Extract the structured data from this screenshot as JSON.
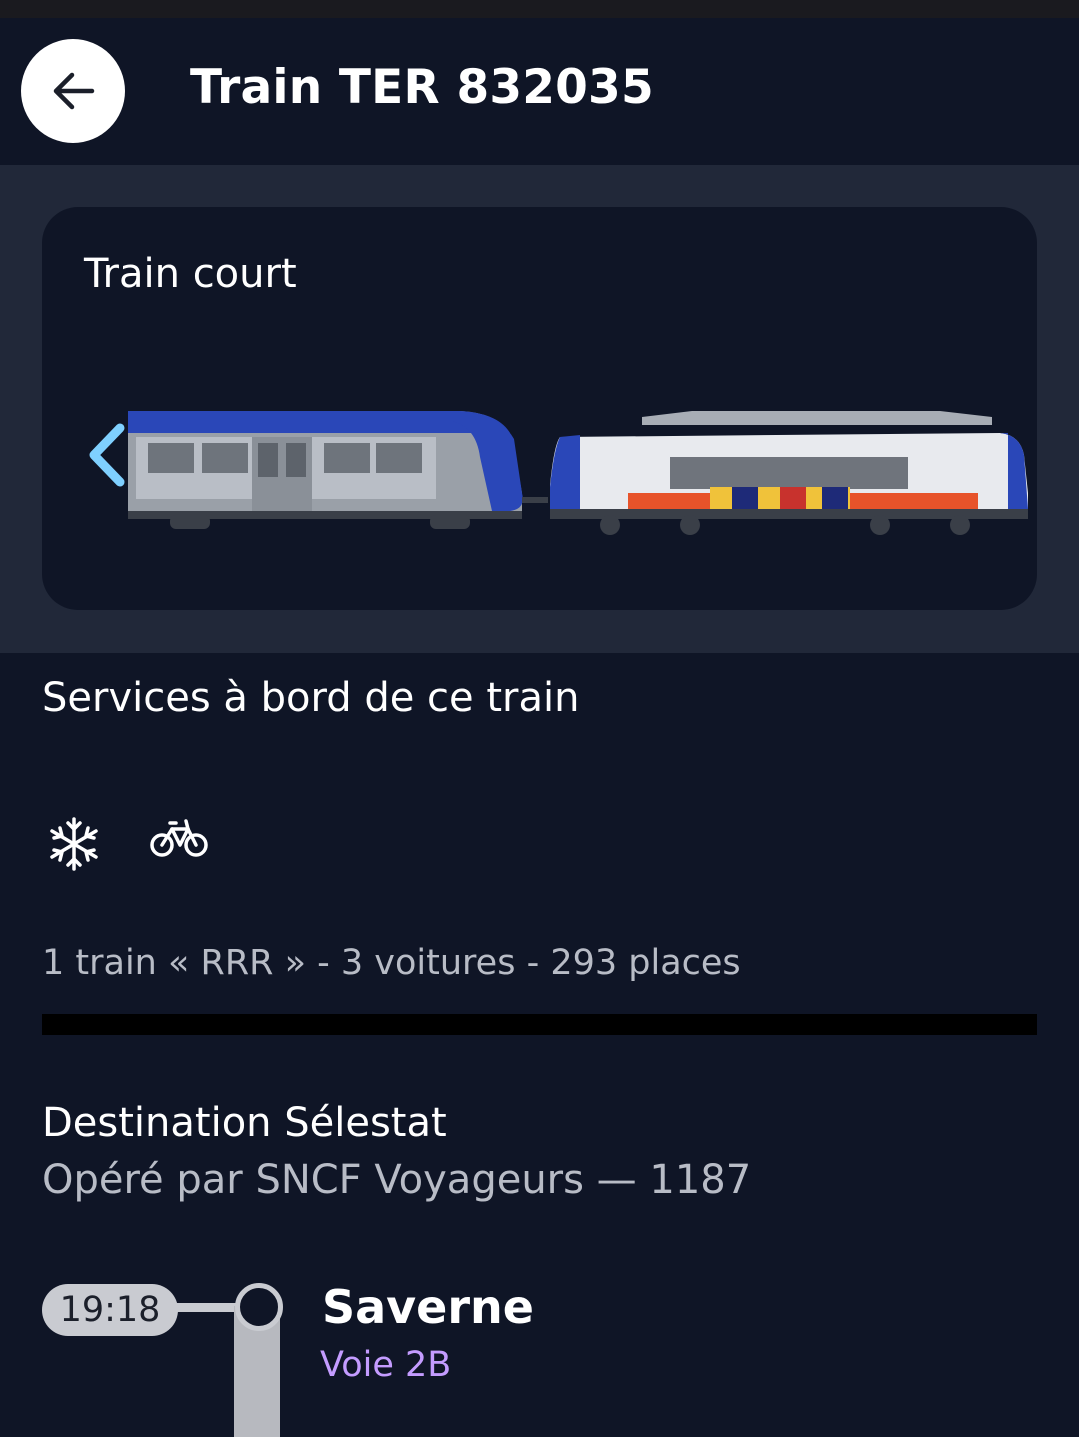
{
  "header": {
    "title": "Train TER 832035",
    "back_icon": "arrow-left-icon"
  },
  "train_visual": {
    "label": "Train court",
    "nav_icon": "chevron-left-icon",
    "accent": "#7fd0ff"
  },
  "services": {
    "title": "Services à bord de ce train",
    "icons": [
      "snowflake-icon",
      "bicycle-icon"
    ],
    "composition": "1 train « RRR » - 3 voitures - 293 places"
  },
  "destination": {
    "title": "Destination Sélestat",
    "operator": "Opéré par SNCF Voyageurs — 1187"
  },
  "stops": [
    {
      "time": "19:18",
      "name": "Saverne",
      "platform": "Voie 2B"
    }
  ],
  "colors": {
    "background": "#0f1526",
    "band": "#212839",
    "platform_text": "#c49cff"
  }
}
